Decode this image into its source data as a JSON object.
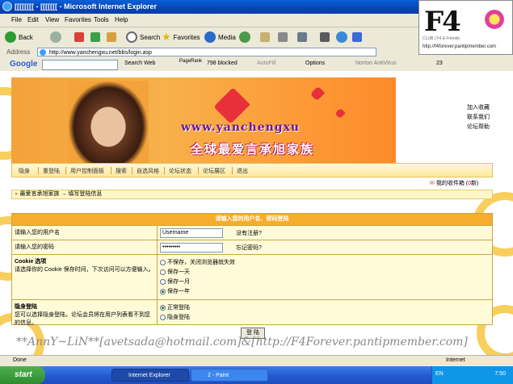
{
  "window": {
    "title": "[[[[[[[[ - [[[[[[[ - Microsoft Internet Explorer"
  },
  "menu": [
    "File",
    "Edit",
    "View",
    "Favorites",
    "Tools",
    "Help"
  ],
  "toolbar": {
    "back": "Back",
    "search": "Search",
    "favorites": "Favorites",
    "media": "Media"
  },
  "address": {
    "label": "Address",
    "url": "http://www.yanchengxu.net/bbs/login.asp"
  },
  "google_bar": {
    "logo": "Google",
    "search_web": "Search Web",
    "pagerank": "PageRank",
    "blocked": "798 blocked",
    "autofill": "AutoFill",
    "options": "Options",
    "norton": "Norton AntiVirus",
    "count": "23"
  },
  "watermark": {
    "logo_text": "F4",
    "logo_url": "http://f4forever.pantipmember.com",
    "logo_sub": "CLUB | F4 & Friends",
    "footer_text": "**AnnY~LiN**[avetsada@hotmail.com]&[http://F4Forever.pantipmember.com]"
  },
  "banner": {
    "site_url": "www.yanchengxu",
    "site_title": "全球最爱言承旭家族"
  },
  "side_links": [
    "加入收藏",
    "联系我们",
    "论坛帮助"
  ],
  "nav": [
    "隐身",
    "重登陆",
    "用户控制面板",
    "搜索",
    "自选风格",
    "论坛状态",
    "论坛展区",
    "退出"
  ],
  "inbox": {
    "label": "我的收件箱",
    "count_prefix": "(",
    "count": "0",
    "count_suffix": "新)"
  },
  "breadcrumb": {
    "forum": "最爱言承旭家族",
    "arrow": "→",
    "page": "填写登陆信息"
  },
  "form": {
    "header": "请输入您的用户名、密码登陆",
    "username_label": "请输入您的用户名",
    "username_value": "Username",
    "register_link": "没有注册?",
    "password_label": "请输入您的密码",
    "password_value": "•••••••••",
    "forgot_link": "忘记密码?",
    "cookie_title": "Cookie 选项",
    "cookie_desc": "请选择你的 Cookie 保存时间，下次访问可以方便输入。",
    "cookie_options": [
      "不保存，关闭浏览器就失效",
      "保存一天",
      "保存一月",
      "保存一年"
    ],
    "hidden_title": "隐身登陆",
    "hidden_desc": "您可以选择隐身登陆，论坛会员将在用户列表看不到您的信息。",
    "hidden_options": [
      "正常登陆",
      "隐身登陆"
    ],
    "submit": "登 陆"
  },
  "status": {
    "left": "Done",
    "right": "Internet"
  },
  "taskbar": {
    "start": "start",
    "task1": "Internet Explorer",
    "task2": "2 - Paint",
    "lang": "EN",
    "clock": "7:50"
  }
}
